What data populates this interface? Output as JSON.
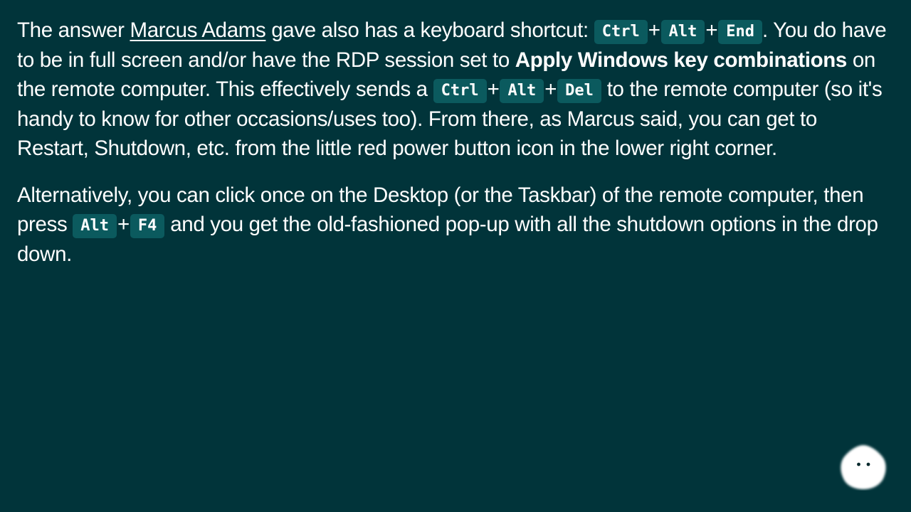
{
  "paragraphs": [
    {
      "p1_a": "The answer ",
      "link": "Marcus Adams",
      "p1_b": " gave also has a keyboard shortcut: ",
      "shortcut1": [
        "Ctrl",
        "Alt",
        "End"
      ],
      "p1_c": ". You do have to be in full screen and/or have the RDP session set to ",
      "bold": "Apply Windows key combinations",
      "p1_d": " on the remote computer. This effectively sends a ",
      "shortcut2": [
        "Ctrl",
        "Alt",
        "Del"
      ],
      "p1_e": " to the remote computer (so it's handy to know for other occasions/uses too). From there, as Marcus said, you can get to Restart, Shutdown, etc. from the little red power button icon in the lower right corner."
    },
    {
      "p2_a": "Alternatively, you can click once on the Desktop (or the Taskbar) of the remote computer, then press ",
      "shortcut": [
        "Alt",
        "F4"
      ],
      "p2_b": " and you get the old-fashioned pop-up with all the shutdown options in the drop down."
    }
  ],
  "plus": "+",
  "icons": {
    "assistant": "mascot-icon"
  }
}
